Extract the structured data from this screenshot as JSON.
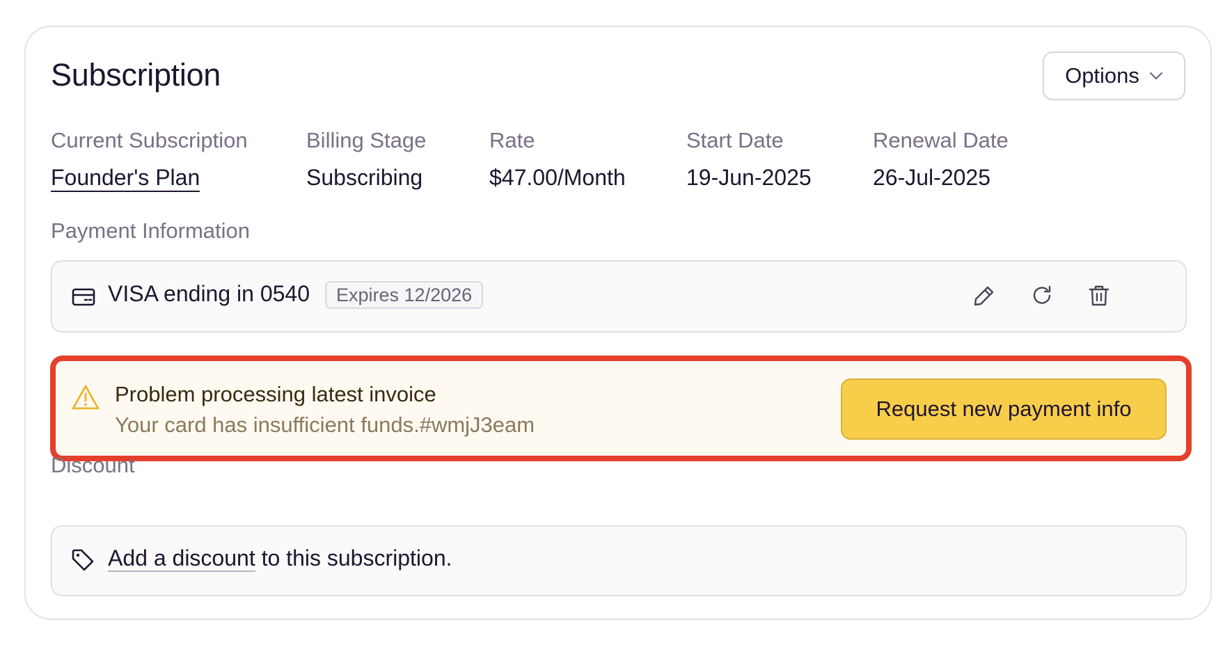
{
  "header": {
    "title": "Subscription",
    "options_label": "Options"
  },
  "summary": [
    {
      "label": "Current Subscription",
      "value": "Founder's Plan"
    },
    {
      "label": "Billing Stage",
      "value": "Subscribing"
    },
    {
      "label": "Rate",
      "value": "$47.00/Month"
    },
    {
      "label": "Start Date",
      "value": "19-Jun-2025"
    },
    {
      "label": "Renewal Date",
      "value": "26-Jul-2025"
    }
  ],
  "payment": {
    "section_label": "Payment Information",
    "card_text": "VISA ending in 0540",
    "expires": "Expires 12/2026",
    "actions": [
      "edit-icon",
      "refresh-icon",
      "trash-icon"
    ]
  },
  "alert": {
    "title": "Problem processing latest invoice",
    "description": "Your card has insufficient funds.#wmjJ3eam",
    "button_label": "Request new payment info",
    "highlight_color": "#e4402b",
    "button_color": "#f7cd4a"
  },
  "discount": {
    "section_label": "Discount",
    "link_text": "Add a discount",
    "suffix_text": " to this subscription."
  }
}
